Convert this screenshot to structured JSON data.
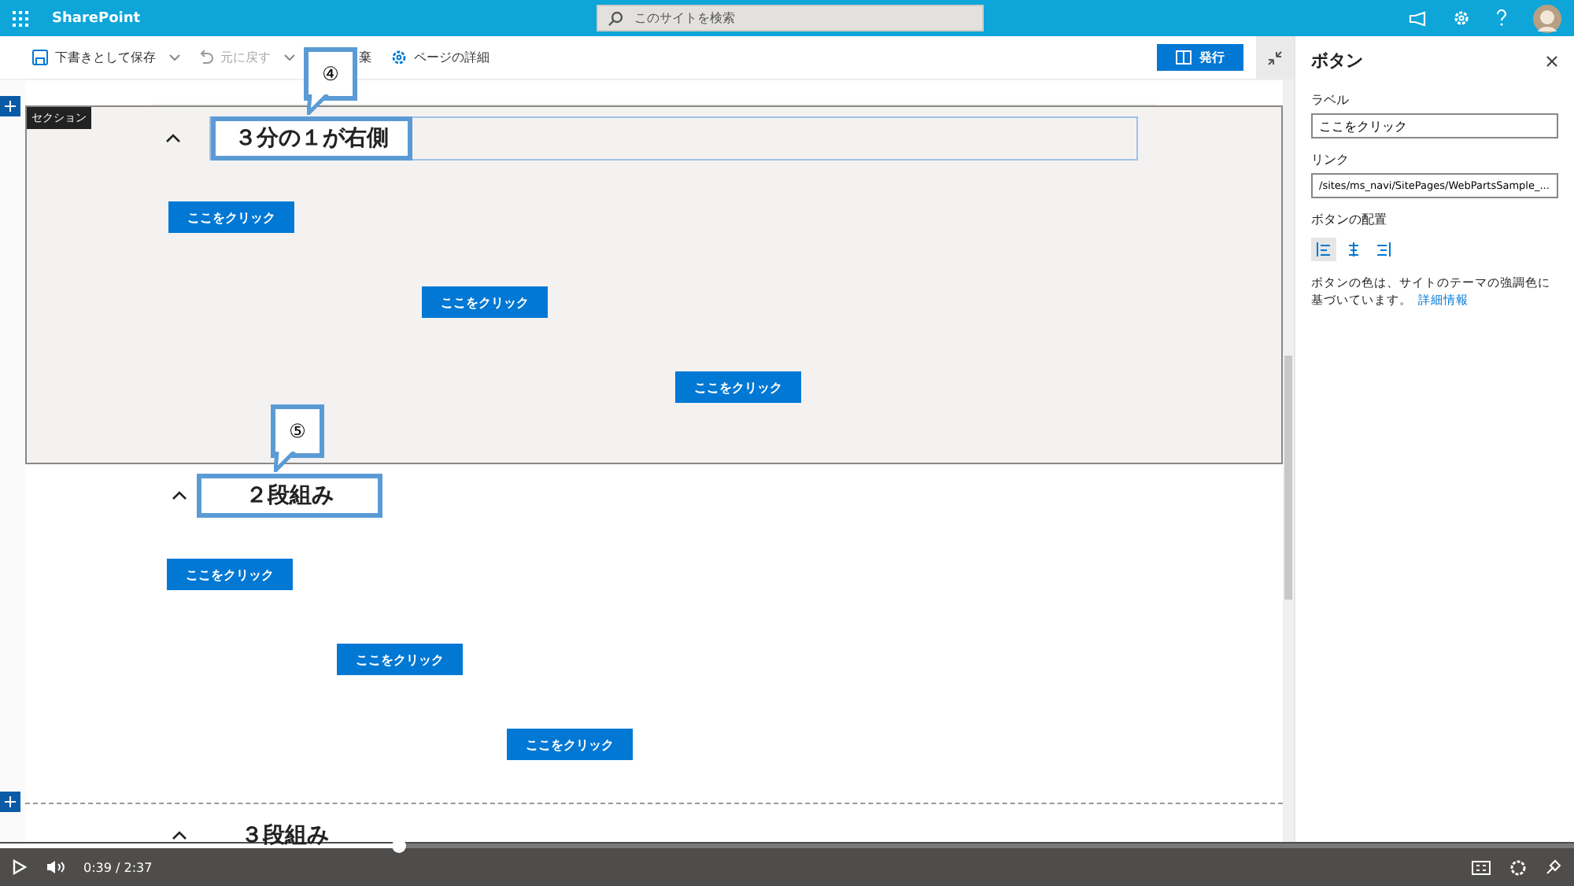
{
  "app_bar": {
    "app_name": "SharePoint",
    "search_placeholder": "このサイトを検索"
  },
  "toolbar": {
    "items": [
      {
        "kind": "save",
        "label": "下書きとして保存",
        "disabled": false,
        "dropdown": true
      },
      {
        "kind": "undo",
        "label": "元に戻す",
        "disabled": true,
        "dropdown": true
      },
      {
        "kind": "discard",
        "label": "棄",
        "disabled": false,
        "dropdown": false
      },
      {
        "kind": "details",
        "label": "ページの詳細",
        "disabled": false,
        "dropdown": false
      }
    ],
    "publish": "発行"
  },
  "sections": [
    {
      "tag": "セクション",
      "selected": true,
      "kind": "one-third-right",
      "title": "３分の１が右側",
      "callout": "④",
      "buttons": [
        "ここをクリック",
        "ここをクリック",
        "ここをクリック"
      ]
    },
    {
      "selected": false,
      "kind": "two-columns",
      "title": "２段組み",
      "callout": "⑤",
      "buttons": [
        "ここをクリック",
        "ここをクリック",
        "ここをクリック"
      ]
    },
    {
      "selected": false,
      "kind": "three-columns",
      "title": "３段組み"
    }
  ],
  "panel": {
    "title": "ボタン",
    "label_caption": "ラベル",
    "label_value": "ここをクリック",
    "link_caption": "リンク",
    "link_value": "/sites/ms_navi/SitePages/WebPartsSample_...",
    "alignment_caption": "ボタンの配置",
    "alignments": [
      {
        "kind": "left",
        "selected": true
      },
      {
        "kind": "center",
        "selected": false
      },
      {
        "kind": "right",
        "selected": false
      }
    ],
    "note": "ボタンの色は、サイトのテーマの強調色に基づいています。",
    "note_link": "詳細情報"
  },
  "video": {
    "level": 0.253,
    "time": "0:39 / 2:37"
  }
}
